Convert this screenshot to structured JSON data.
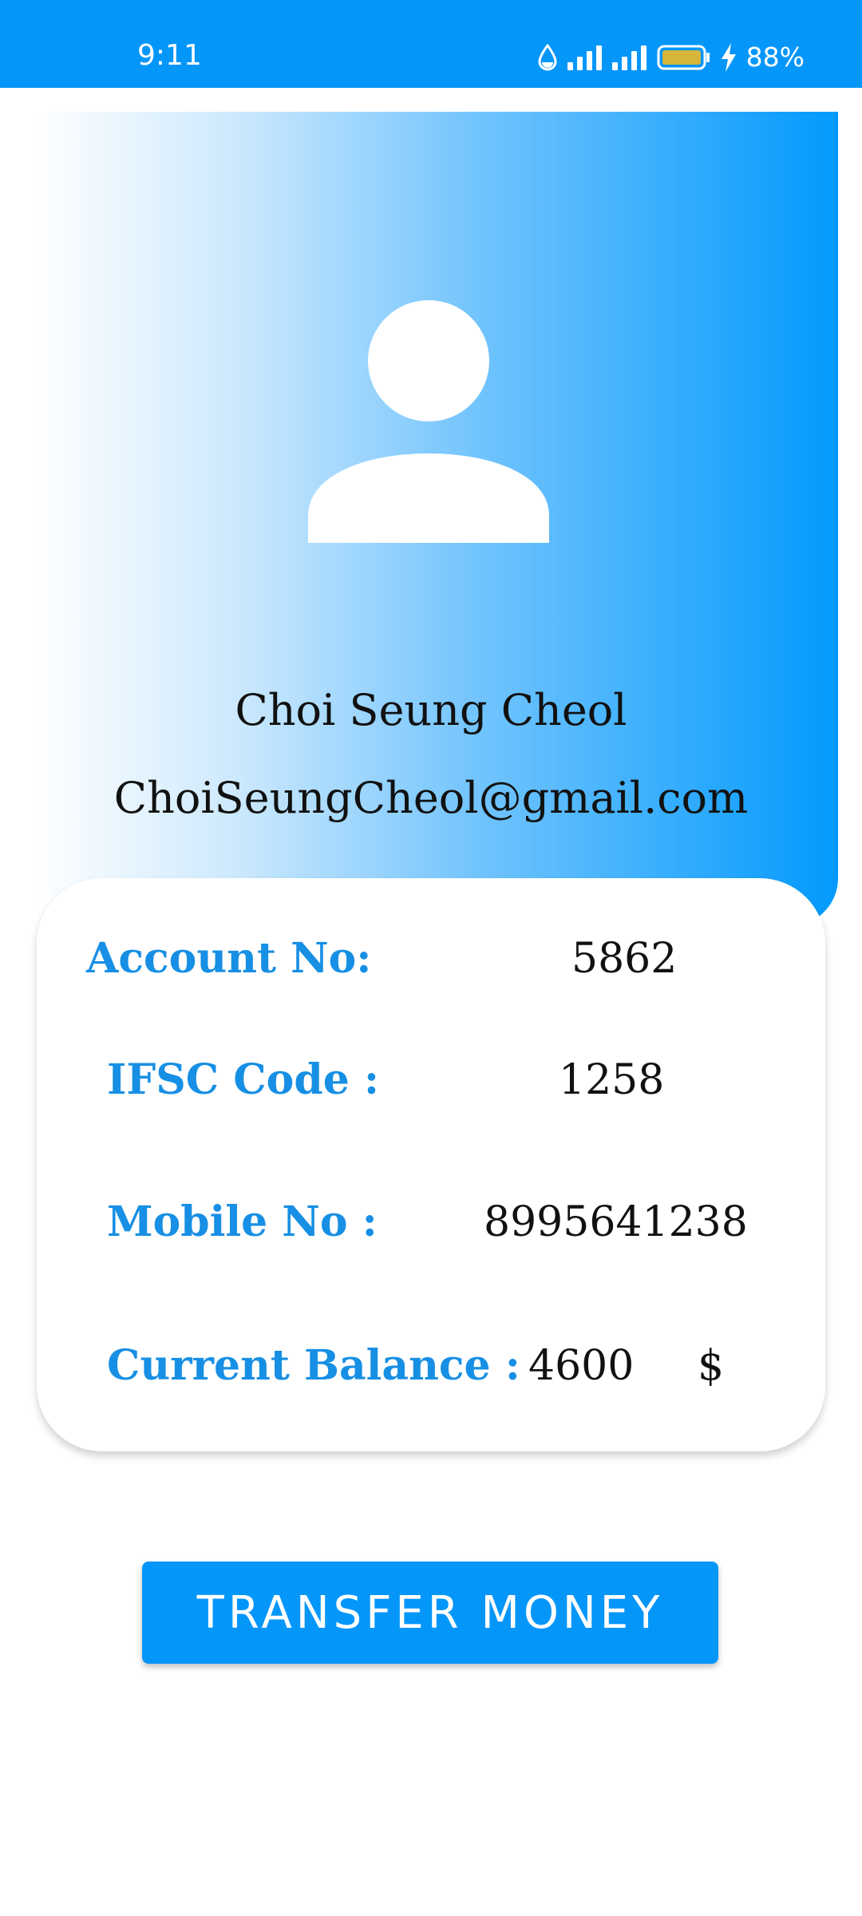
{
  "status_bar": {
    "time": "9:11",
    "battery_percent": "88%",
    "icons": [
      "water-drop-icon",
      "signal-icon",
      "signal-icon",
      "battery-icon",
      "charging-bolt-icon"
    ],
    "background_color": "#0596fa",
    "battery_fill_color": "#d4b63a"
  },
  "profile": {
    "avatar_icon": "person-icon",
    "name": "Choi Seung Cheol",
    "email": "ChoiSeungCheol@gmail.com"
  },
  "details": {
    "account_label": "Account No:",
    "account_value": "5862",
    "ifsc_label": "IFSC Code :",
    "ifsc_value": "1258",
    "mobile_label": "Mobile No :",
    "mobile_value": "8995641238",
    "balance_label": "Current Balance :",
    "balance_value": "4600",
    "currency_symbol": "$"
  },
  "actions": {
    "transfer_label": "TRANSFER MONEY"
  },
  "colors": {
    "accent": "#0596fa",
    "label_blue": "#178fe4",
    "gradient_end": "#039afd"
  }
}
